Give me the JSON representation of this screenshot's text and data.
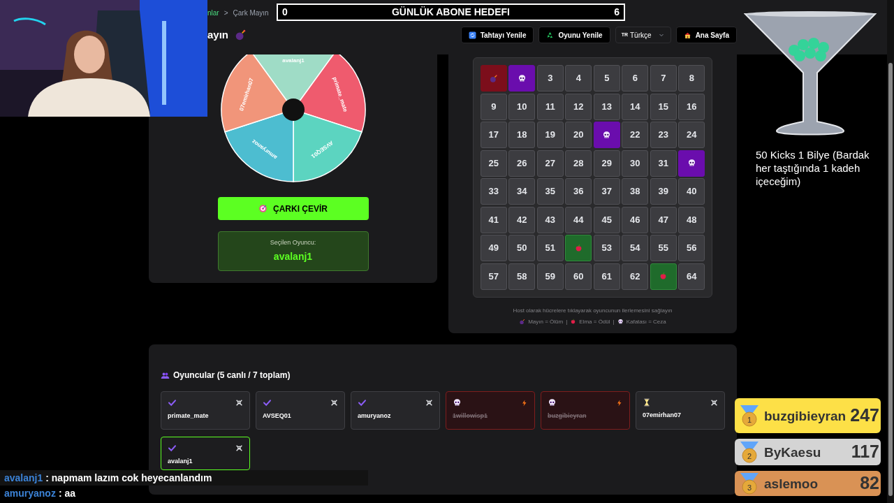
{
  "breadcrumb": {
    "parent": "nlar",
    "separator": ">",
    "current": "Çark Mayın"
  },
  "page_title": "ayın",
  "goal_bar": {
    "current": "0",
    "title": "GÜNLÜK ABONE HEDEFI",
    "target": "6"
  },
  "toolbar": [
    {
      "kind": "refresh",
      "label": "Tahtayı Yenile"
    },
    {
      "kind": "recycle",
      "label": "Oyunu Yenile"
    },
    {
      "kind": "language",
      "code": "TR",
      "label": "Türkçe"
    },
    {
      "kind": "home",
      "label": "Ana Sayfa"
    }
  ],
  "wheel": {
    "slices": [
      {
        "label": "avalanj1",
        "color": "#9fdcc6"
      },
      {
        "label": "primate_mate",
        "color": "#ef5b6e"
      },
      {
        "label": "AVSEQ01",
        "color": "#5cd4c0"
      },
      {
        "label": "amuryanoz",
        "color": "#4dbdd0"
      },
      {
        "label": "07emirhan07",
        "color": "#f1957a"
      }
    ],
    "spin_button": "ÇARKI ÇEVİR",
    "selected_label": "Seçilen Oyuncu:",
    "selected_player": "avalanj1"
  },
  "board": {
    "cells": [
      {
        "kind": "mine"
      },
      {
        "kind": "skull"
      },
      {
        "kind": "number",
        "label": "3"
      },
      {
        "kind": "number",
        "label": "4"
      },
      {
        "kind": "number",
        "label": "5"
      },
      {
        "kind": "number",
        "label": "6"
      },
      {
        "kind": "number",
        "label": "7"
      },
      {
        "kind": "number",
        "label": "8"
      },
      {
        "kind": "number",
        "label": "9"
      },
      {
        "kind": "number",
        "label": "10"
      },
      {
        "kind": "number",
        "label": "11"
      },
      {
        "kind": "number",
        "label": "12"
      },
      {
        "kind": "number",
        "label": "13"
      },
      {
        "kind": "number",
        "label": "14"
      },
      {
        "kind": "number",
        "label": "15"
      },
      {
        "kind": "number",
        "label": "16"
      },
      {
        "kind": "number",
        "label": "17"
      },
      {
        "kind": "number",
        "label": "18"
      },
      {
        "kind": "number",
        "label": "19"
      },
      {
        "kind": "number",
        "label": "20"
      },
      {
        "kind": "skull"
      },
      {
        "kind": "number",
        "label": "22"
      },
      {
        "kind": "number",
        "label": "23"
      },
      {
        "kind": "number",
        "label": "24"
      },
      {
        "kind": "number",
        "label": "25"
      },
      {
        "kind": "number",
        "label": "26"
      },
      {
        "kind": "number",
        "label": "27"
      },
      {
        "kind": "number",
        "label": "28"
      },
      {
        "kind": "number",
        "label": "29"
      },
      {
        "kind": "number",
        "label": "30"
      },
      {
        "kind": "number",
        "label": "31"
      },
      {
        "kind": "skull"
      },
      {
        "kind": "number",
        "label": "33"
      },
      {
        "kind": "number",
        "label": "34"
      },
      {
        "kind": "number",
        "label": "35"
      },
      {
        "kind": "number",
        "label": "36"
      },
      {
        "kind": "number",
        "label": "37"
      },
      {
        "kind": "number",
        "label": "38"
      },
      {
        "kind": "number",
        "label": "39"
      },
      {
        "kind": "number",
        "label": "40"
      },
      {
        "kind": "number",
        "label": "41"
      },
      {
        "kind": "number",
        "label": "42"
      },
      {
        "kind": "number",
        "label": "43"
      },
      {
        "kind": "number",
        "label": "44"
      },
      {
        "kind": "number",
        "label": "45"
      },
      {
        "kind": "number",
        "label": "46"
      },
      {
        "kind": "number",
        "label": "47"
      },
      {
        "kind": "number",
        "label": "48"
      },
      {
        "kind": "number",
        "label": "49"
      },
      {
        "kind": "number",
        "label": "50"
      },
      {
        "kind": "number",
        "label": "51"
      },
      {
        "kind": "apple"
      },
      {
        "kind": "number",
        "label": "53"
      },
      {
        "kind": "number",
        "label": "54"
      },
      {
        "kind": "number",
        "label": "55"
      },
      {
        "kind": "number",
        "label": "56"
      },
      {
        "kind": "number",
        "label": "57"
      },
      {
        "kind": "number",
        "label": "58"
      },
      {
        "kind": "number",
        "label": "59"
      },
      {
        "kind": "number",
        "label": "60"
      },
      {
        "kind": "number",
        "label": "61"
      },
      {
        "kind": "number",
        "label": "62"
      },
      {
        "kind": "apple"
      },
      {
        "kind": "number",
        "label": "64"
      }
    ],
    "hint": "Host olarak hücrelere tıklayarak oyuncunun ilerlemesini sağlayın",
    "legend": [
      {
        "kind": "mine",
        "label": "Mayın = Ölüm"
      },
      {
        "kind": "apple",
        "label": "Elma = Ödül"
      },
      {
        "kind": "skull",
        "label": "Kafatası = Ceza"
      }
    ],
    "legend_separator": "|"
  },
  "players": {
    "title": "Oyuncular (5 canlı / 7 toplam)",
    "items": [
      {
        "name": "primate_mate",
        "kind": "alive",
        "selected": false
      },
      {
        "name": "AVSEQ01",
        "kind": "alive",
        "selected": false
      },
      {
        "name": "amuryanoz",
        "kind": "alive",
        "selected": false
      },
      {
        "name": "1willowisp1",
        "kind": "dead",
        "selected": false
      },
      {
        "name": "buzgibieyran",
        "kind": "dead",
        "selected": false
      },
      {
        "name": "07emirhan07",
        "kind": "waiting",
        "selected": false
      },
      {
        "name": "avalanj1",
        "kind": "alive",
        "selected": true
      }
    ]
  },
  "overlay": {
    "glass_caption": "50 Kicks 1 Bilye (Bardak her taştığında 1 kadeh içeceğim)",
    "leaderboard": [
      {
        "rank": "1",
        "name": "buzgibieyran",
        "score": "247",
        "color": "#fde047"
      },
      {
        "rank": "2",
        "name": "ByKaesu",
        "score": "117",
        "color": "#d4d4d4"
      },
      {
        "rank": "3",
        "name": "aslemoo",
        "score": "82",
        "color": "#d99255"
      }
    ],
    "chat": [
      {
        "user": "avalanj1",
        "text": ": napmam lazım cok heyecanlandım"
      },
      {
        "user": "amuryanoz",
        "text": ": aa"
      }
    ]
  }
}
